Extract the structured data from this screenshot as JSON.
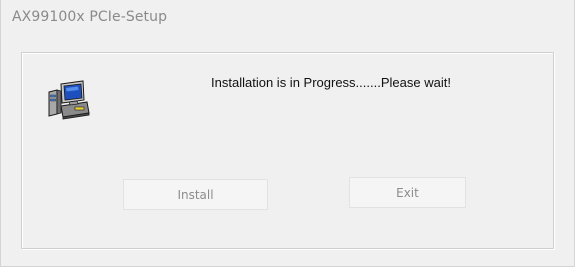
{
  "window": {
    "title": "AX99100x PCIe-Setup"
  },
  "dialog": {
    "icon": "computer-setup-icon",
    "message": "Installation is in Progress.......Please wait!"
  },
  "buttons": {
    "install_label": "Install",
    "exit_label": "Exit"
  },
  "colors": {
    "window_background": "#f0f0f0",
    "title_text": "#8a8a8a",
    "disabled_text": "#8c8c8c"
  }
}
